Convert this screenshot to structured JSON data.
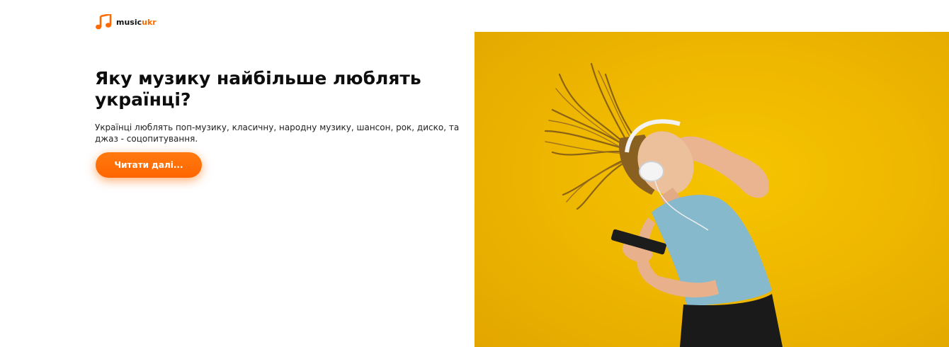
{
  "brand": {
    "logo_icon": "music-note-icon",
    "name_part1": "music",
    "name_part2": "ukr",
    "accent_color": "#ff6a00"
  },
  "hero": {
    "title": "Яку музику найбільше люблять українці?",
    "description": "Українці люблять поп-музику, класичну, народну музику, шансон, рок, диско, та джаз - соцопитування.",
    "cta_label": "Читати далі...",
    "image_subject": "woman-with-headphones-dancing",
    "image_background_color": "#f2bb00"
  }
}
